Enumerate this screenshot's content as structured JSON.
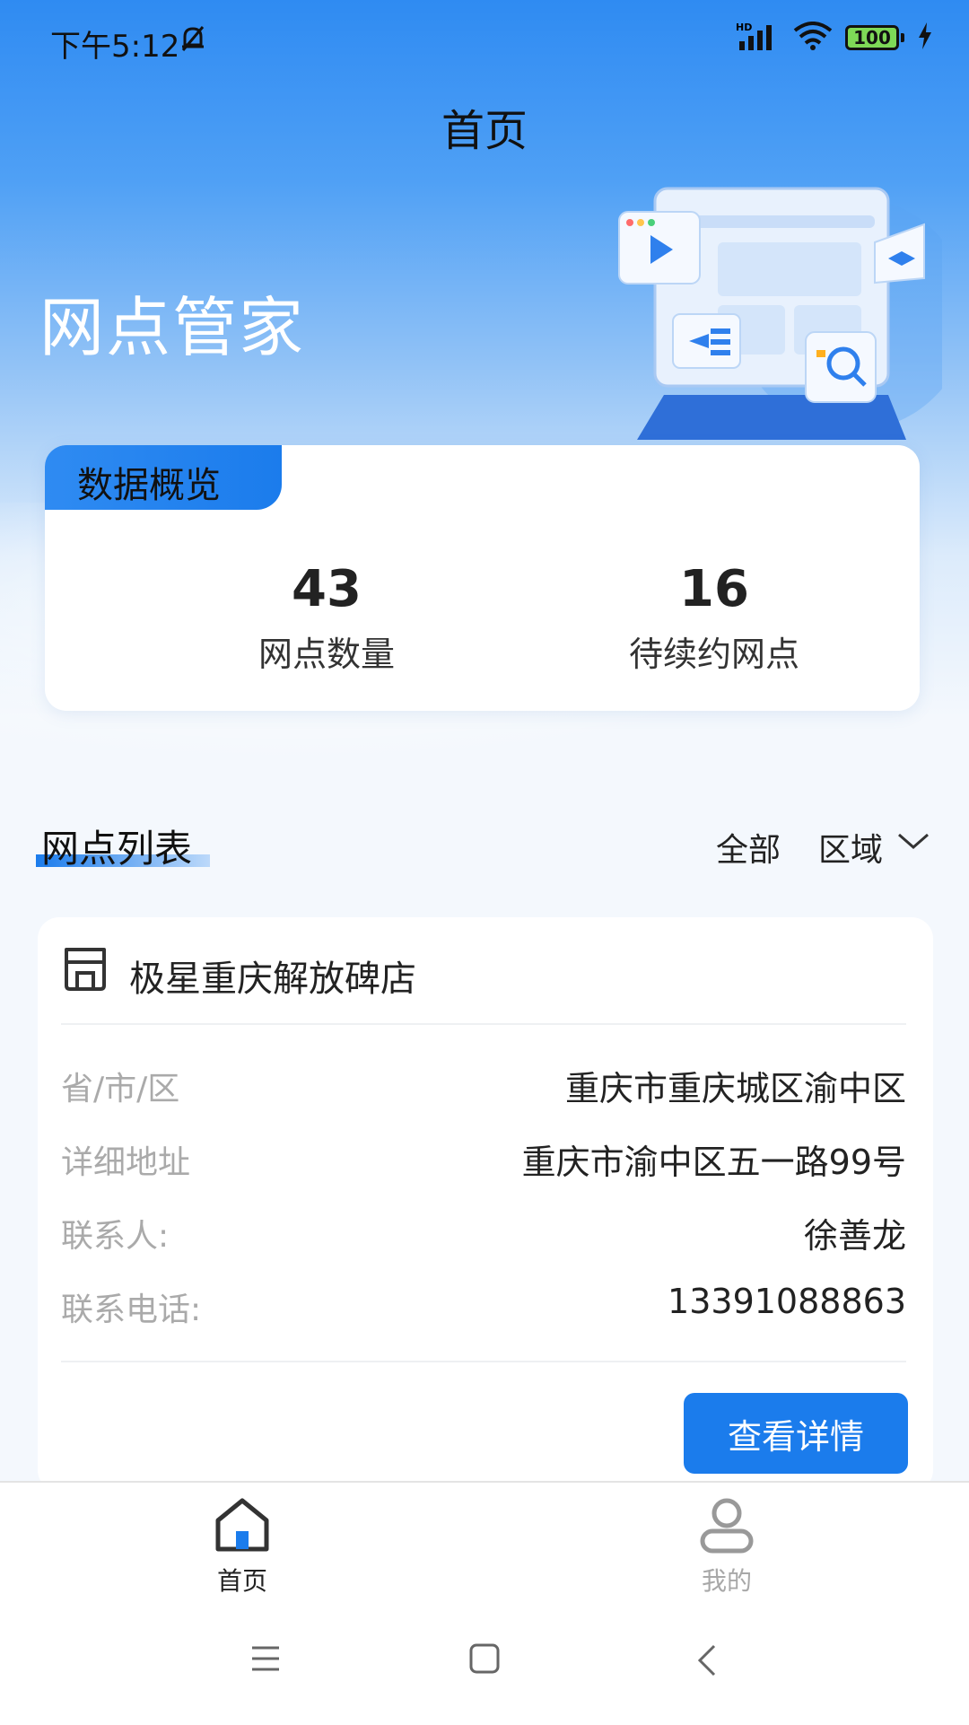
{
  "status_bar": {
    "time": "下午5:12",
    "battery": "100",
    "network": "HD"
  },
  "header": {
    "title": "首页"
  },
  "hero": {
    "brand": "网点管家"
  },
  "overview": {
    "tab_label": "数据概览",
    "stats": [
      {
        "value": "43",
        "label": "网点数量"
      },
      {
        "value": "16",
        "label": "待续约网点"
      }
    ]
  },
  "list": {
    "title": "网点列表",
    "filter_all": "全部",
    "filter_region": "区域"
  },
  "store": {
    "name": "极星重庆解放碑店",
    "rows": [
      {
        "label": "省/市/区",
        "value": "重庆市重庆城区渝中区"
      },
      {
        "label": "详细地址",
        "value": "重庆市渝中区五一路99号"
      },
      {
        "label": "联系人:",
        "value": "徐善龙"
      },
      {
        "label": "联系电话:",
        "value": "13391088863"
      }
    ],
    "detail_button": "查看详情"
  },
  "bottom_nav": {
    "items": [
      {
        "label": "首页",
        "icon": "home-icon",
        "active": true
      },
      {
        "label": "我的",
        "icon": "user-icon",
        "active": false
      }
    ]
  },
  "colors": {
    "accent": "#1b7cec",
    "header_gradient_top": "#2f8bf2"
  }
}
